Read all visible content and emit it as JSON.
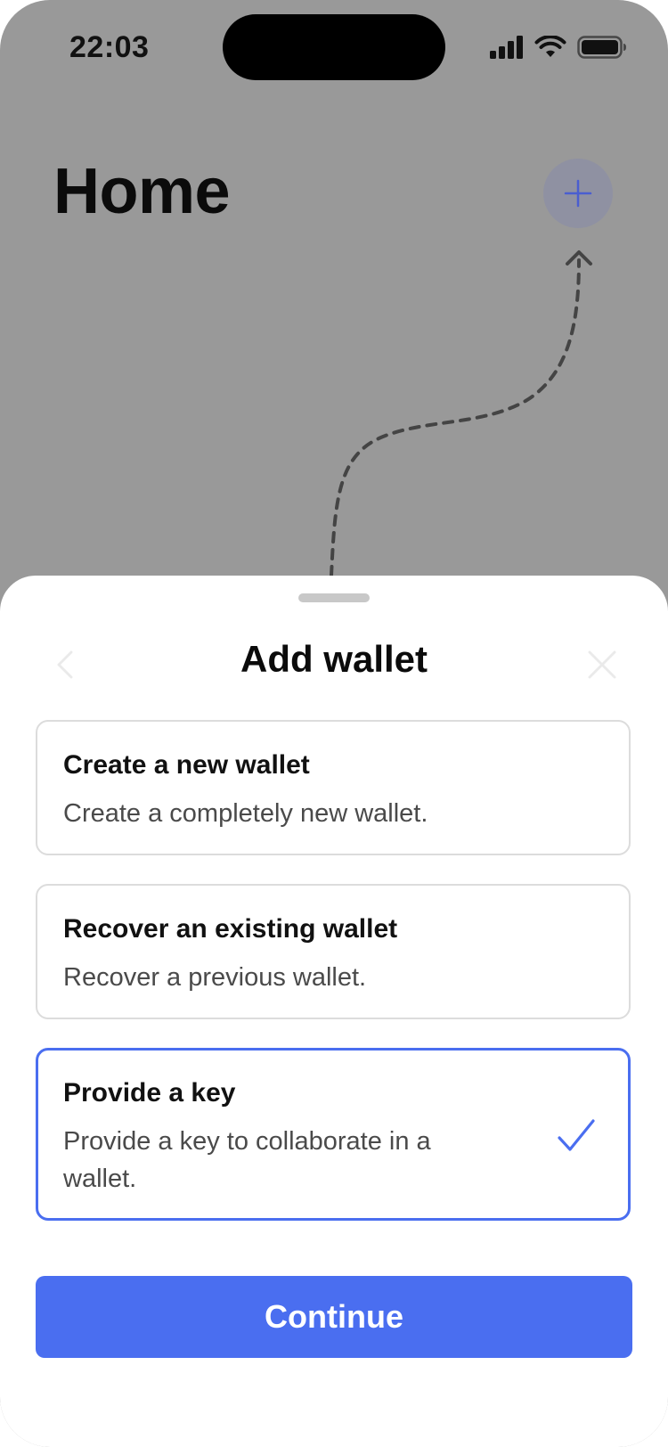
{
  "status_bar": {
    "time": "22:03",
    "icons": [
      "cellular-signal-icon",
      "wifi-icon",
      "battery-icon"
    ]
  },
  "home": {
    "title": "Home",
    "add_icon": "plus-icon"
  },
  "sheet": {
    "title": "Add wallet",
    "back_icon": "chevron-left-icon",
    "close_icon": "close-icon",
    "options": [
      {
        "title": "Create a new wallet",
        "description": "Create a completely new wallet.",
        "selected": false
      },
      {
        "title": "Recover an existing wallet",
        "description": "Recover a previous wallet.",
        "selected": false
      },
      {
        "title": "Provide a key",
        "description": "Provide a key to collaborate in a wallet.",
        "selected": true
      }
    ],
    "continue_label": "Continue"
  },
  "colors": {
    "accent": "#4a6ef0",
    "backdrop": "#999999",
    "option_border": "#dcdcdc"
  }
}
